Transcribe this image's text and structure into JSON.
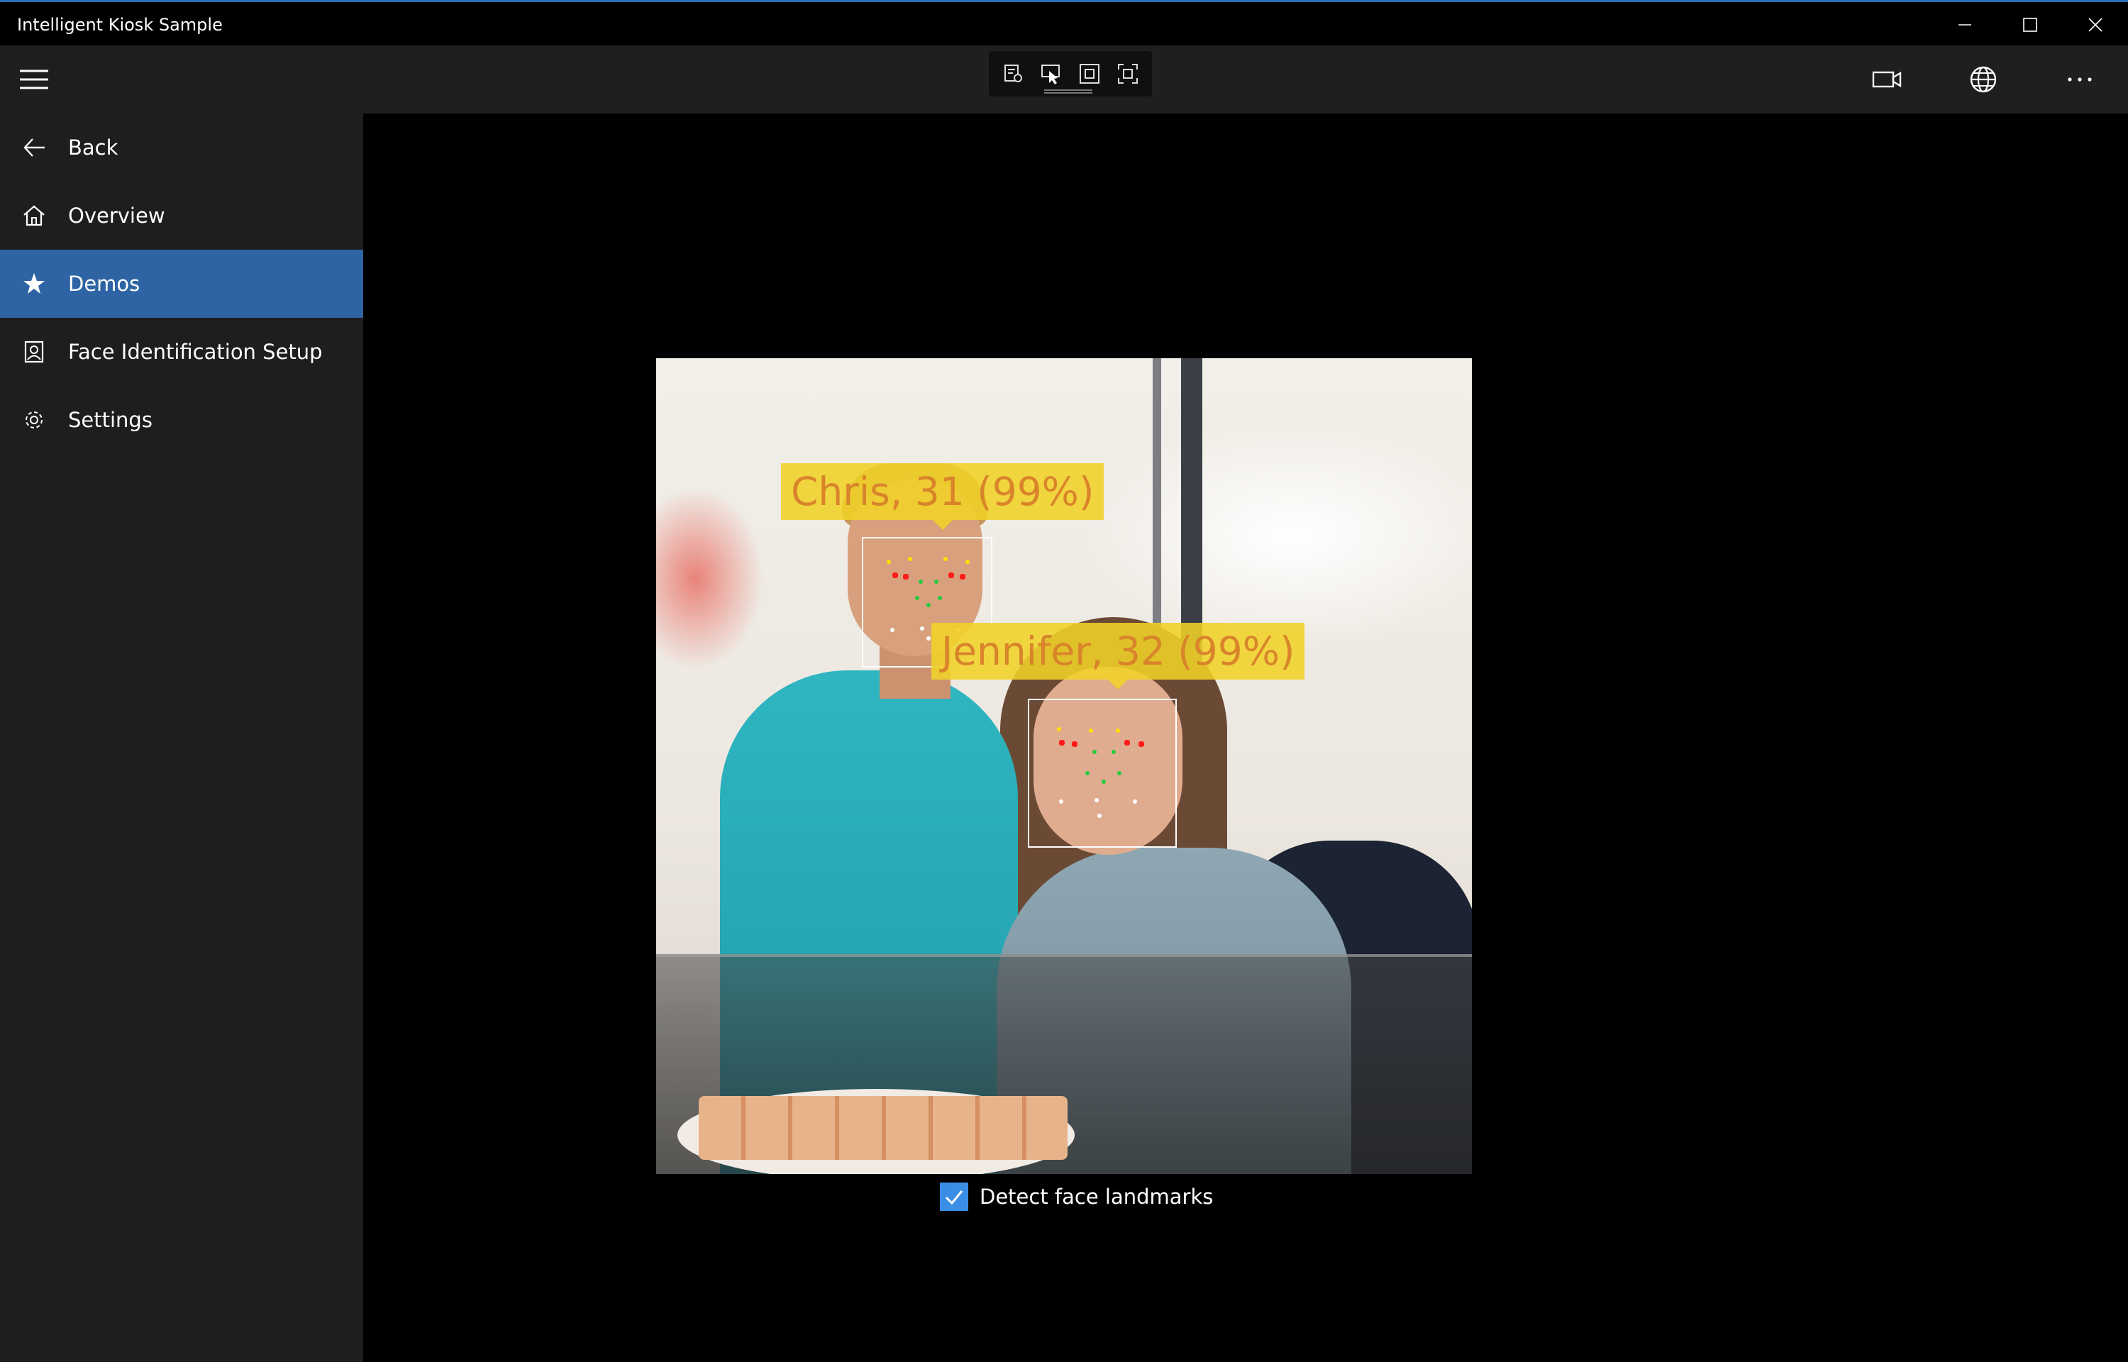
{
  "window": {
    "title": "Intelligent Kiosk Sample",
    "controls": [
      {
        "name": "minimize",
        "icon": "minimize-icon"
      },
      {
        "name": "maximize",
        "icon": "maximize-icon"
      },
      {
        "name": "close",
        "icon": "close-icon"
      }
    ]
  },
  "sidebar": {
    "menu_icon": "hamburger-menu-icon",
    "items": [
      {
        "label": "Back",
        "icon": "back-arrow-icon",
        "selected": false
      },
      {
        "label": "Overview",
        "icon": "home-icon",
        "selected": false
      },
      {
        "label": "Demos",
        "icon": "star-icon",
        "selected": true
      },
      {
        "label": "Face Identification Setup",
        "icon": "contact-frame-icon",
        "selected": false
      },
      {
        "label": "Settings",
        "icon": "gear-icon",
        "selected": false
      }
    ],
    "selected_color": "#2e64a3"
  },
  "toolbar": {
    "tools": [
      "edit-image-icon",
      "select-pointer-icon",
      "rectangle-select-icon",
      "free-select-icon"
    ],
    "right_buttons": [
      "camera-icon",
      "globe-icon",
      "more-icon"
    ]
  },
  "main": {
    "faces": [
      {
        "label": "Chris, 31 (99%)"
      },
      {
        "label": "Jennifer, 32 (99%)"
      }
    ],
    "label_color": "#f0d228",
    "landmarks_checkbox": {
      "label": "Detect face landmarks",
      "checked": true,
      "color": "#3a8ee6"
    }
  }
}
